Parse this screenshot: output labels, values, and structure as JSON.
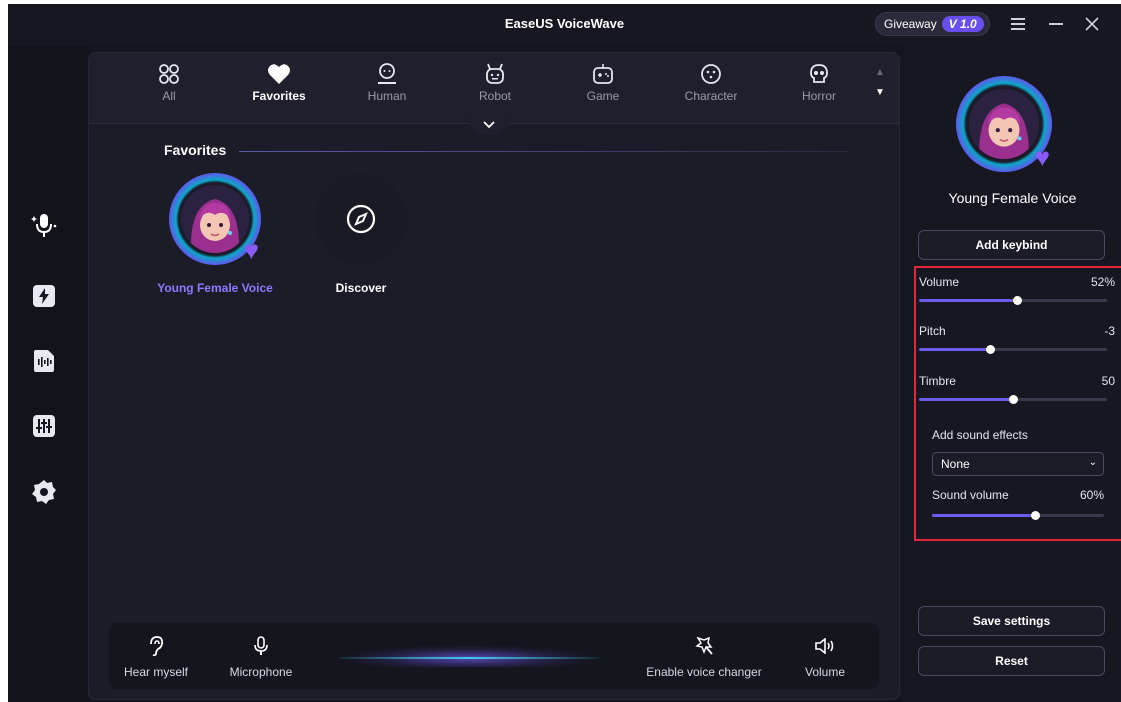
{
  "window": {
    "title": "EaseUS VoiceWave",
    "giveaway_label": "Giveaway",
    "version_badge": "V 1.0"
  },
  "sidebar": {
    "items": [
      {
        "name": "voice-changer",
        "icon": "microphone-sparkle-icon",
        "active": true
      },
      {
        "name": "soundboard",
        "icon": "lightning-icon",
        "active": false
      },
      {
        "name": "audio-file",
        "icon": "audio-file-icon",
        "active": false
      },
      {
        "name": "equalizer",
        "icon": "mixer-icon",
        "active": false
      },
      {
        "name": "settings",
        "icon": "gear-icon",
        "active": false
      }
    ]
  },
  "categories": [
    {
      "label": "All",
      "icon": "grid-icon"
    },
    {
      "label": "Favorites",
      "icon": "heart-icon",
      "active": true
    },
    {
      "label": "Human",
      "icon": "person-icon"
    },
    {
      "label": "Robot",
      "icon": "robot-icon"
    },
    {
      "label": "Game",
      "icon": "gamepad-icon"
    },
    {
      "label": "Character",
      "icon": "character-icon"
    },
    {
      "label": "Horror",
      "icon": "skull-icon"
    }
  ],
  "section": {
    "title": "Favorites"
  },
  "cards": [
    {
      "label": "Young Female Voice",
      "selected": true
    },
    {
      "label": "Discover"
    }
  ],
  "bottom_bar": {
    "hear_myself": "Hear myself",
    "microphone": "Microphone",
    "enable_voice_changer": "Enable voice changer",
    "volume": "Volume"
  },
  "right_panel": {
    "voice_name": "Young Female Voice",
    "add_keybind": "Add keybind",
    "volume_label": "Volume",
    "volume_value": "52%",
    "volume_fraction": 0.52,
    "pitch_label": "Pitch",
    "pitch_value": "-3",
    "pitch_fraction": 0.38,
    "timbre_label": "Timbre",
    "timbre_value": "50",
    "timbre_fraction": 0.5,
    "sound_effects_label": "Add sound effects",
    "sound_effects_selected": "None",
    "sound_volume_label": "Sound volume",
    "sound_volume_value": "60%",
    "sound_volume_fraction": 0.6,
    "save_settings": "Save settings",
    "reset": "Reset"
  },
  "colors": {
    "accent": "#6a5cf0",
    "highlight_border": "#e0283a",
    "selected_label": "#8a7cff"
  }
}
